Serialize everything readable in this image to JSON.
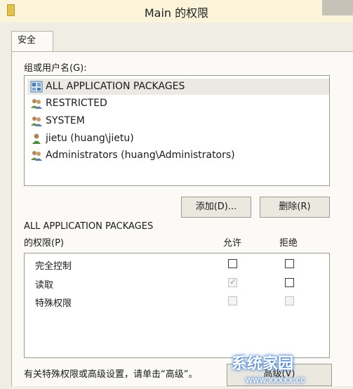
{
  "window": {
    "title": "Main 的权限"
  },
  "tabs": [
    {
      "label": "安全"
    }
  ],
  "groups": {
    "label": "组或用户名(G):",
    "items": [
      {
        "name": "ALL APPLICATION PACKAGES",
        "icon": "packages-group-icon",
        "selected": true
      },
      {
        "name": "RESTRICTED",
        "icon": "user-group-icon"
      },
      {
        "name": "SYSTEM",
        "icon": "user-group-icon"
      },
      {
        "name": "jietu (huang\\jietu)",
        "icon": "single-user-icon"
      },
      {
        "name": "Administrators (huang\\Administrators)",
        "icon": "user-group-icon"
      }
    ]
  },
  "buttons": {
    "add": "添加(D)...",
    "remove": "删除(R)",
    "advanced": "高级(V)"
  },
  "permissions": {
    "heading_line1": "ALL APPLICATION PACKAGES",
    "heading_line2": "的权限(P)",
    "allow_header": "允许",
    "deny_header": "拒绝",
    "rows": [
      {
        "name": "完全控制",
        "allow": false,
        "deny": false,
        "disabled": false
      },
      {
        "name": "读取",
        "allow": true,
        "deny": false,
        "disabled": false,
        "allow_disabled": true
      },
      {
        "name": "特殊权限",
        "allow": false,
        "deny": false,
        "disabled": true
      }
    ]
  },
  "footer": {
    "hint": "有关特殊权限或高级设置，请单击“高级”。"
  },
  "watermark": {
    "text": "系统家园",
    "sub": "www.xxxxx.cc"
  },
  "colors": {
    "titlebar": "#fbf4da",
    "panel": "#fbfaf6",
    "selection": "#ebe9e4"
  }
}
